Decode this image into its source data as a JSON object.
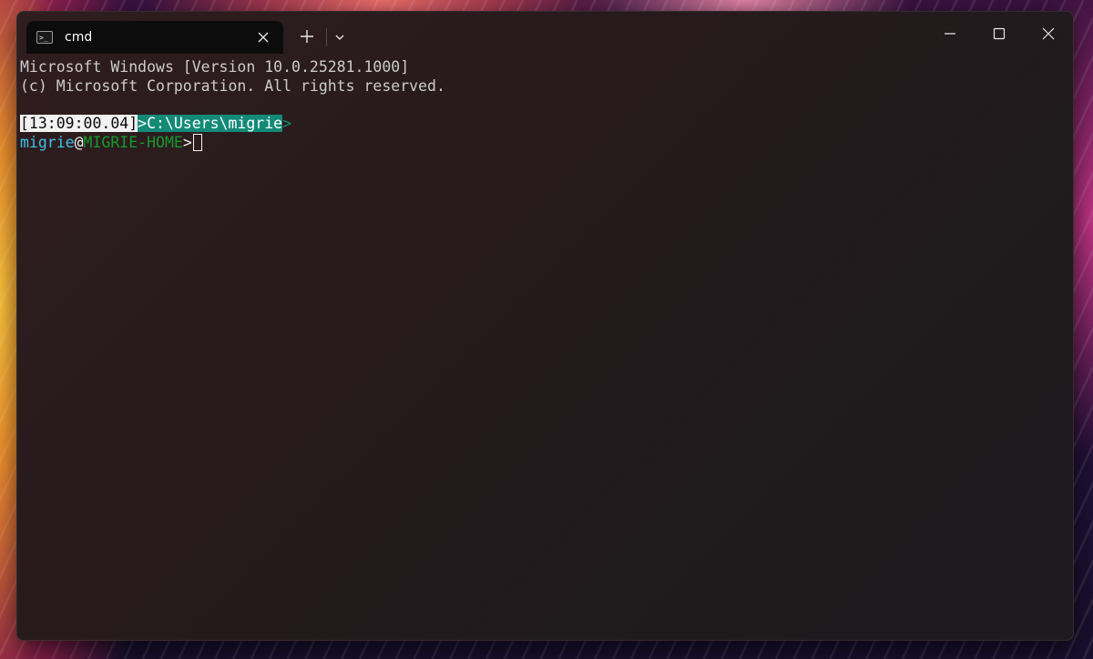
{
  "window": {
    "tabs": [
      {
        "title": "cmd",
        "icon": "terminal-icon",
        "icon_glyph": ">_"
      }
    ],
    "newtab_icon": "plus-icon",
    "dropdown_icon": "chevron-down-icon",
    "caption_buttons": [
      "minimize-icon",
      "maximize-icon",
      "close-icon"
    ]
  },
  "terminal": {
    "line1": "Microsoft Windows [Version 10.0.25281.1000]",
    "line2": "(c) Microsoft Corporation. All rights reserved.",
    "prompt": {
      "timestamp": "[13:09:00.04]",
      "path": ">C:\\Users\\migrie",
      "path_suffix": ">",
      "user": "migrie",
      "at": "@",
      "host": "MIGRIE-HOME",
      "gt": ">"
    }
  },
  "colors": {
    "terminal_bg": "#0c0c0c",
    "timestamp_bg": "#f2f2f2",
    "path_bg": "#138a78",
    "user": "#3fc1e8",
    "host": "#139a2a"
  }
}
